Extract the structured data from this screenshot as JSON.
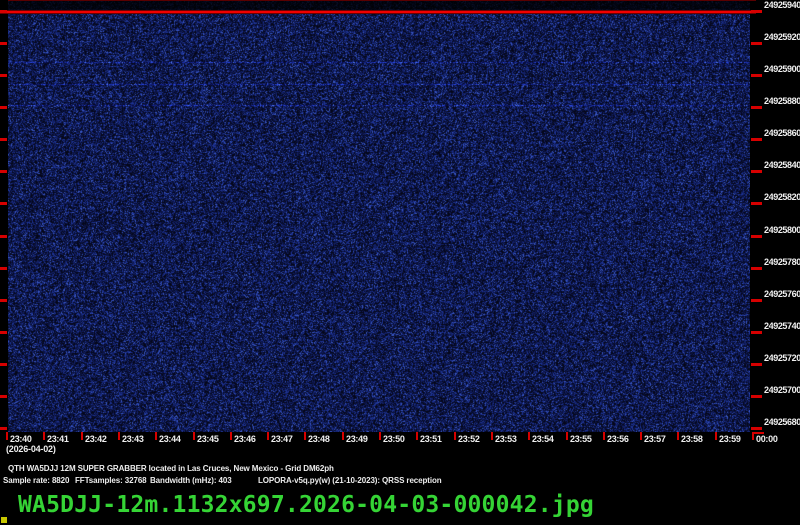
{
  "colors": {
    "background": "#000000",
    "tick_red": "#d60000",
    "scan_line_red": "#f00000",
    "label_white": "#f0f0f0",
    "filename_green": "#35d435",
    "marker_yellow": "#c8c800",
    "noise_palette": [
      "#050719",
      "#0b1340",
      "#132168",
      "#1e3496",
      "#3a58c4"
    ]
  },
  "freq_axis": {
    "labels": [
      "24925940",
      "24925920",
      "24925900",
      "24925880",
      "24925860",
      "24925840",
      "24925820",
      "24925800",
      "24925780",
      "24925760",
      "24925740",
      "24925720",
      "24925700",
      "24925680"
    ]
  },
  "time_axis": {
    "labels": [
      "23:40",
      "23:41",
      "23:42",
      "23:43",
      "23:44",
      "23:45",
      "23:46",
      "23:47",
      "23:48",
      "23:49",
      "23:50",
      "23:51",
      "23:52",
      "23:53",
      "23:54",
      "23:55",
      "23:56",
      "23:57",
      "23:58",
      "23:59",
      "00:00"
    ],
    "date": "(2026-04-02)"
  },
  "info": {
    "line1": "QTH WA5DJJ 12M SUPER GRABBER located in Las Cruces, New Mexico - Grid DM62ph",
    "sample_rate": "Sample rate: 8820",
    "fft_samples": "FFTsamples: 32768",
    "bandwidth": "Bandwidth (mHz): 403",
    "software": "LOPORA-v5q.py(w) (21-10-2023): QRSS reception"
  },
  "filename": "WA5DJJ-12m.1132x697.2026-04-03-000042.jpg",
  "chart_data": {
    "type": "heatmap",
    "subtype": "QRSS spectrogram waterfall",
    "description": "Blue background radio noise; no visible QRSS signals. Bright red horizontal marker line near top of waterfall.",
    "x_ticks": [
      "23:40",
      "23:41",
      "23:42",
      "23:43",
      "23:44",
      "23:45",
      "23:46",
      "23:47",
      "23:48",
      "23:49",
      "23:50",
      "23:51",
      "23:52",
      "23:53",
      "23:54",
      "23:55",
      "23:56",
      "23:57",
      "23:58",
      "23:59",
      "00:00"
    ],
    "x_date": "(2026-04-02)",
    "y_ticks_hz": [
      24925940,
      24925920,
      24925900,
      24925880,
      24925860,
      24925840,
      24925820,
      24925800,
      24925780,
      24925760,
      24925740,
      24925720,
      24925700,
      24925680
    ],
    "y_range_hz": [
      24925680,
      24925940
    ],
    "x_range": [
      "23:40",
      "00:00"
    ],
    "grid": false,
    "legend": "none",
    "marker_line_freq_hz": 24925940
  }
}
